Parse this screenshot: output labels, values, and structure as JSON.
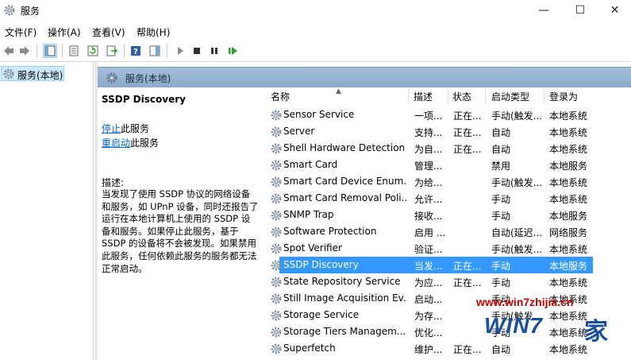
{
  "window": {
    "title": "服务"
  },
  "menubar": {
    "items": [
      "文件(F)",
      "操作(A)",
      "查看(V)",
      "帮助(H)"
    ]
  },
  "toolbar": {
    "icons": [
      "back-arrow-icon",
      "forward-arrow-icon",
      "show-tree-icon",
      "properties-icon",
      "refresh-icon",
      "export-list-icon",
      "help-icon",
      "toggle-action-pane-icon",
      "start-service-icon",
      "stop-service-icon",
      "pause-service-icon",
      "restart-service-icon"
    ]
  },
  "tree": {
    "item": "服务(本地)"
  },
  "content": {
    "header": "服务(本地)"
  },
  "detail": {
    "service_name": "SSDP Discovery",
    "stop_link": "停止",
    "stop_suffix": "此服务",
    "restart_link": "重启动",
    "restart_suffix": "此服务",
    "desc_label": "描述:",
    "desc_text": "当发现了使用 SSDP 协议的网络设备和服务，如 UPnP 设备，同时还报告了运行在本地计算机上使用的 SSDP 设备和服务。如果停止此服务，基于 SSDP 的设备将不会被发现。如果禁用此服务，任何依赖此服务的服务都无法正常启动。"
  },
  "list": {
    "columns": {
      "name": "名称",
      "desc": "描述",
      "status": "状态",
      "startup": "启动类型",
      "logon": "登录为"
    },
    "rows": [
      {
        "name": "Sensor Service",
        "desc": "一项...",
        "status": "正在...",
        "startup": "手动(触发...",
        "logon": "本地系统"
      },
      {
        "name": "Server",
        "desc": "支持...",
        "status": "正在...",
        "startup": "自动",
        "logon": "本地系统"
      },
      {
        "name": "Shell Hardware Detection",
        "desc": "为自...",
        "status": "正在...",
        "startup": "自动",
        "logon": "本地系统"
      },
      {
        "name": "Smart Card",
        "desc": "管理...",
        "status": "",
        "startup": "禁用",
        "logon": "本地服务"
      },
      {
        "name": "Smart Card Device Enum...",
        "desc": "为给...",
        "status": "",
        "startup": "手动(触发...",
        "logon": "本地系统"
      },
      {
        "name": "Smart Card Removal Poli...",
        "desc": "允许...",
        "status": "",
        "startup": "手动",
        "logon": "本地系统"
      },
      {
        "name": "SNMP Trap",
        "desc": "接收...",
        "status": "",
        "startup": "手动",
        "logon": "本地服务"
      },
      {
        "name": "Software Protection",
        "desc": "启用 ...",
        "status": "",
        "startup": "自动(延迟...",
        "logon": "网络服务"
      },
      {
        "name": "Spot Verifier",
        "desc": "验证...",
        "status": "",
        "startup": "手动(触发...",
        "logon": "本地系统"
      },
      {
        "name": "SSDP Discovery",
        "desc": "当发...",
        "status": "正在...",
        "startup": "手动",
        "logon": "本地服务"
      },
      {
        "name": "State Repository Service",
        "desc": "为应...",
        "status": "正在...",
        "startup": "手动",
        "logon": "本地系统"
      },
      {
        "name": "Still Image Acquisition Ev...",
        "desc": "启动...",
        "status": "",
        "startup": "手动",
        "logon": "本地系统"
      },
      {
        "name": "Storage Service",
        "desc": "为存...",
        "status": "",
        "startup": "手动(触发...",
        "logon": "本地系统"
      },
      {
        "name": "Storage Tiers Managem...",
        "desc": "优化...",
        "status": "",
        "startup": "手动",
        "logon": "本地系统"
      },
      {
        "name": "Superfetch",
        "desc": "维护...",
        "status": "正在...",
        "startup": "自动",
        "logon": "本地系统"
      }
    ],
    "selected_index": 9
  },
  "watermark": {
    "url": "www.win7zhijia.cn",
    "brand": "WIN7",
    "brand_suffix": "家"
  },
  "colors": {
    "selection": "#3399ff",
    "header": "#a5bfd9",
    "link": "#0066cc",
    "tree_selected": "#cce8ff"
  }
}
